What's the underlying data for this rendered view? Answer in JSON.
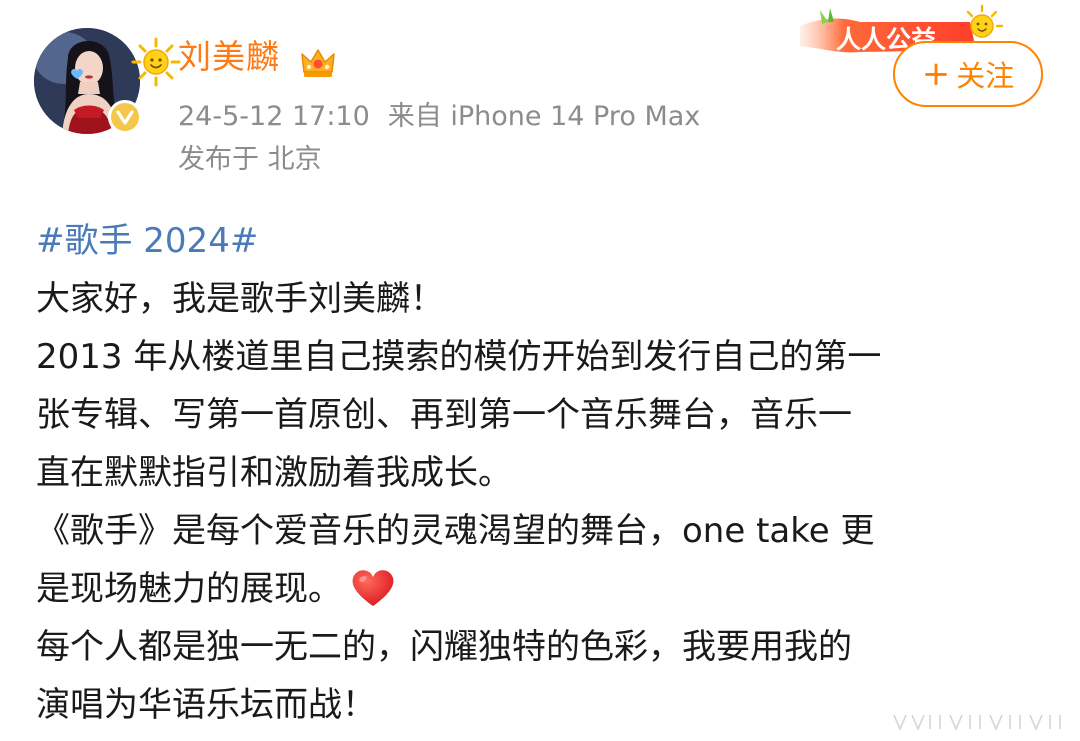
{
  "author": {
    "name": "刘美麟",
    "timestamp": "24-5-12 17:10",
    "source": "来自 iPhone 14 Pro Max",
    "location": "发布于 北京"
  },
  "follow_button": {
    "plus": "+",
    "label": "关注"
  },
  "campaign_badge": {
    "text": "人人公益"
  },
  "post": {
    "hashtag": "#歌手 2024#",
    "lines": [
      "大家好，我是歌手刘美麟！",
      "2013 年从楼道里自己摸索的模仿开始到发行自己的第一",
      "张专辑、写第一首原创、再到第一个音乐舞台，音乐一",
      "直在默默指引和激励着我成长。",
      "《歌手》是每个爱音乐的灵魂渴望的舞台，one take 更",
      "是现场魅力的展现。",
      "每个人都是独一无二的，闪耀独特的色彩，我要用我的",
      "演唱为华语乐坛而战！"
    ]
  },
  "icons": {
    "crown": "crown-icon",
    "verified": "verified-badge-icon",
    "heart": "red-heart-emoji"
  },
  "colors": {
    "username": "#ff7a14",
    "hashtag": "#4a7ab8",
    "follow": "#ff8200",
    "meta": "#8c8c8c",
    "heart": "#e8262e"
  }
}
